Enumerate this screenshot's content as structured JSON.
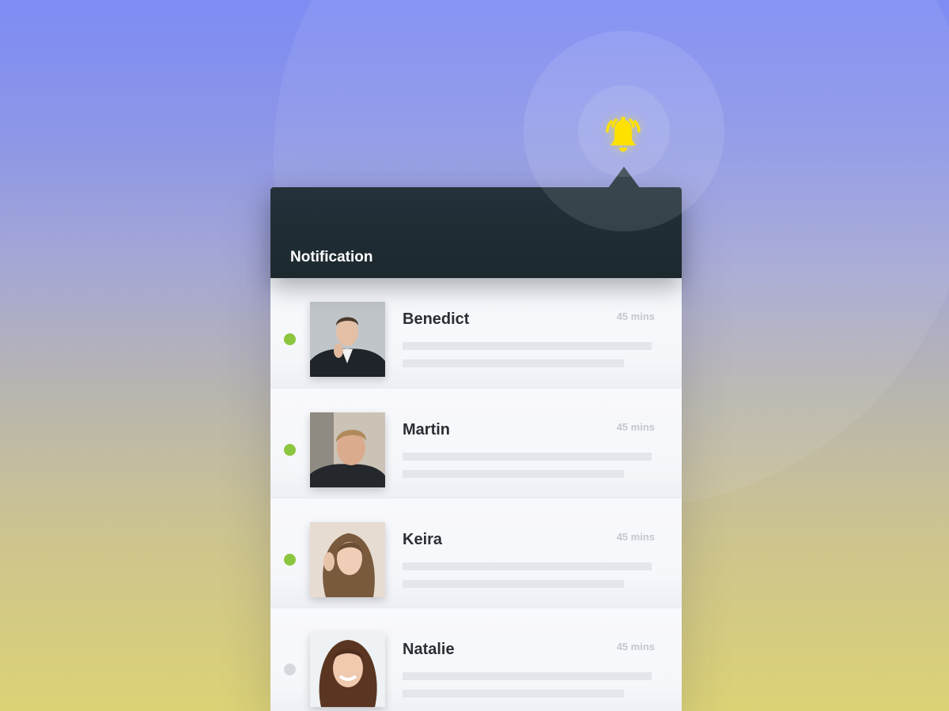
{
  "header": {
    "title": "Notification"
  },
  "colors": {
    "online": "#8cc63f",
    "offline": "#d6d8dd",
    "bell": "#ffe100",
    "header_bg": "#1f2b32"
  },
  "icons": {
    "bell": "bell-icon"
  },
  "notifications": [
    {
      "name": "Benedict",
      "time": "45 mins",
      "status": "online"
    },
    {
      "name": "Martin",
      "time": "45 mins",
      "status": "online"
    },
    {
      "name": "Keira",
      "time": "45 mins",
      "status": "online"
    },
    {
      "name": "Natalie",
      "time": "45 mins",
      "status": "offline"
    }
  ]
}
